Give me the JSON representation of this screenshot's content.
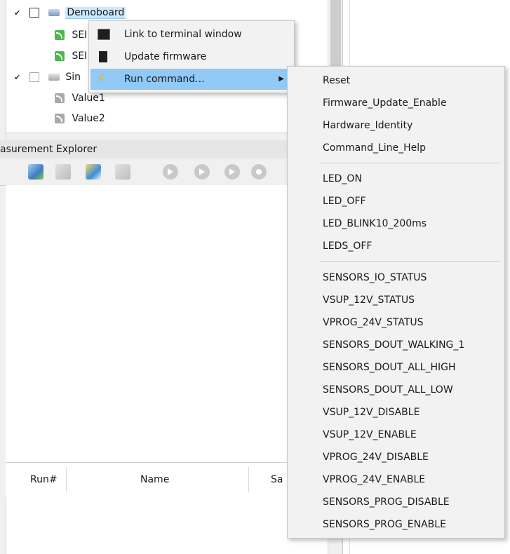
{
  "tree": {
    "items": [
      {
        "label": "Demoboard"
      },
      {
        "label": "SEI"
      },
      {
        "label": "SEI"
      },
      {
        "label": "Sin"
      },
      {
        "label": "Value1"
      },
      {
        "label": "Value2"
      }
    ]
  },
  "explorer": {
    "title": "asurement Explorer"
  },
  "table": {
    "columns": [
      "Run#",
      "Name",
      "Sa"
    ]
  },
  "context_menu": {
    "items": [
      {
        "label": "Link to terminal window",
        "icon": "terminal-icon"
      },
      {
        "label": "Update firmware",
        "icon": "chip-icon"
      },
      {
        "label": "Run command...",
        "icon": "lightning-icon",
        "arrow": "▶"
      }
    ]
  },
  "submenu": {
    "group1": [
      "Reset",
      "Firmware_Update_Enable",
      "Hardware_Identity",
      "Command_Line_Help"
    ],
    "group2": [
      "LED_ON",
      "LED_OFF",
      "LED_BLINK10_200ms",
      "LEDS_OFF"
    ],
    "group3": [
      "SENSORS_IO_STATUS",
      "VSUP_12V_STATUS",
      "VPROG_24V_STATUS",
      "SENSORS_DOUT_WALKING_1",
      "SENSORS_DOUT_ALL_HIGH",
      "SENSORS_DOUT_ALL_LOW",
      "VSUP_12V_DISABLE",
      "VSUP_12V_ENABLE",
      "VPROG_24V_DISABLE",
      "VPROG_24V_ENABLE",
      "SENSORS_PROG_DISABLE",
      "SENSORS_PROG_ENABLE"
    ]
  },
  "colors": {
    "highlight": "#91c9f7",
    "selection": "#cce8ff"
  }
}
